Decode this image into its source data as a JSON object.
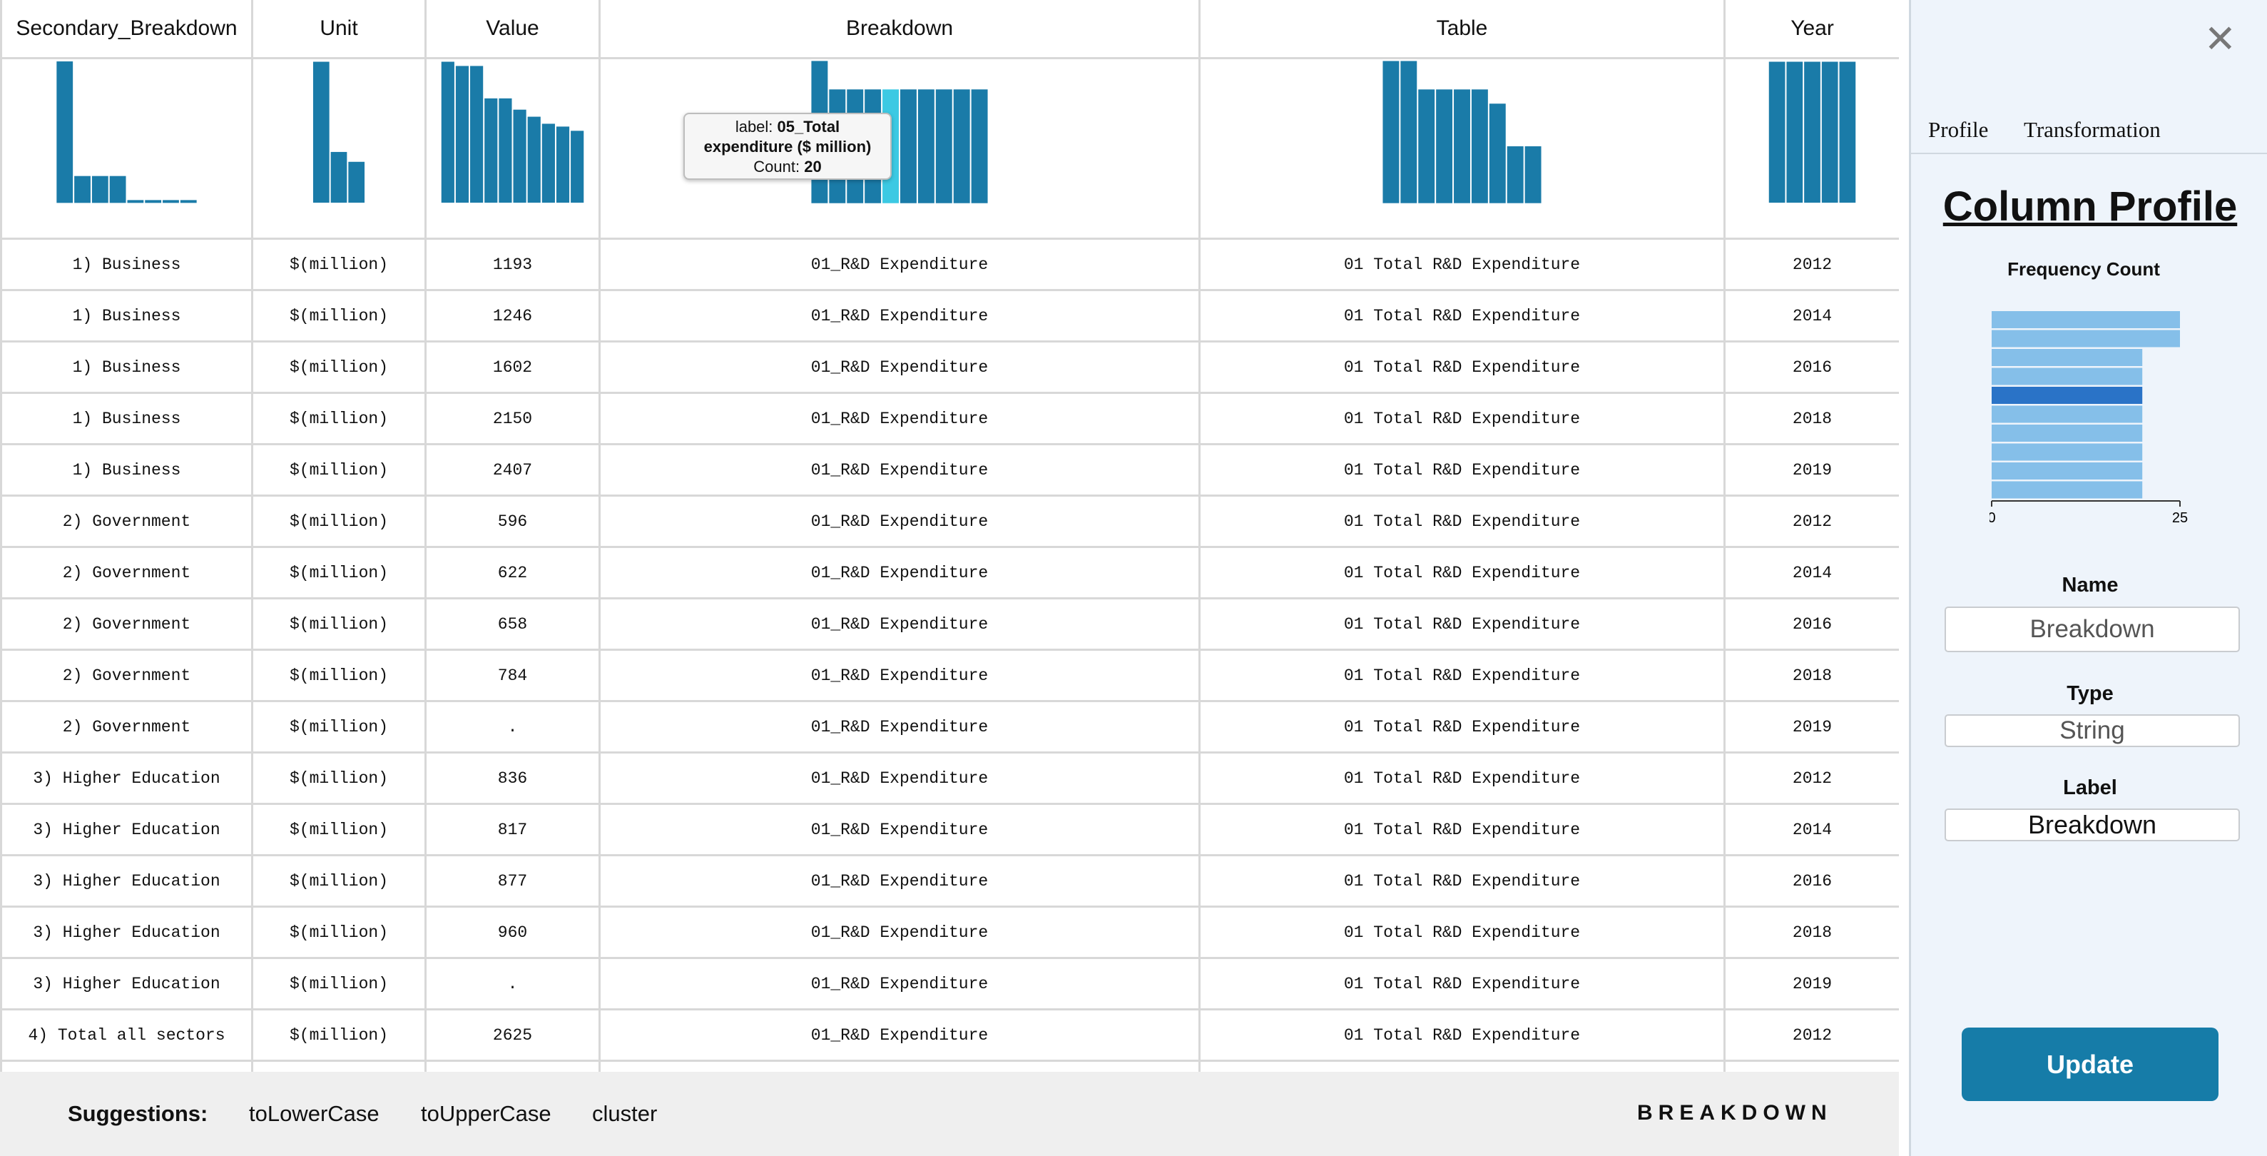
{
  "columns": [
    {
      "label": "Secondary_Breakdown",
      "hist": [
        1,
        0.19,
        0.19,
        0.19,
        0.02,
        0.02,
        0.02,
        0.02
      ]
    },
    {
      "label": "Unit",
      "hist": [
        1,
        0.36,
        0.29
      ]
    },
    {
      "label": "Value",
      "hist": [
        1,
        0.97,
        0.97,
        0.74,
        0.74,
        0.66,
        0.61,
        0.56,
        0.54,
        0.51
      ]
    },
    {
      "label": "Breakdown",
      "hist": [
        1,
        0.8,
        0.8,
        0.8,
        0.8,
        0.8,
        0.8,
        0.8,
        0.8,
        0.8
      ],
      "highlight": 4
    },
    {
      "label": "Table",
      "hist": [
        1,
        1,
        0.8,
        0.8,
        0.8,
        0.8,
        0.7,
        0.4,
        0.4
      ]
    },
    {
      "label": "Year",
      "hist": [
        1,
        1,
        1,
        1,
        1
      ]
    }
  ],
  "tooltip": {
    "label_prefix": "label: ",
    "label_value_a": "05_Total",
    "label_value_b": "expenditure ($ million)",
    "count_prefix": "Count: ",
    "count_value": "20"
  },
  "rows": [
    [
      "1) Business",
      "$(million)",
      "1193",
      "01_R&D Expenditure",
      "01 Total R&D Expenditure",
      "2012"
    ],
    [
      "1) Business",
      "$(million)",
      "1246",
      "01_R&D Expenditure",
      "01 Total R&D Expenditure",
      "2014"
    ],
    [
      "1) Business",
      "$(million)",
      "1602",
      "01_R&D Expenditure",
      "01 Total R&D Expenditure",
      "2016"
    ],
    [
      "1) Business",
      "$(million)",
      "2150",
      "01_R&D Expenditure",
      "01 Total R&D Expenditure",
      "2018"
    ],
    [
      "1) Business",
      "$(million)",
      "2407",
      "01_R&D Expenditure",
      "01 Total R&D Expenditure",
      "2019"
    ],
    [
      "2) Government",
      "$(million)",
      "596",
      "01_R&D Expenditure",
      "01 Total R&D Expenditure",
      "2012"
    ],
    [
      "2) Government",
      "$(million)",
      "622",
      "01_R&D Expenditure",
      "01 Total R&D Expenditure",
      "2014"
    ],
    [
      "2) Government",
      "$(million)",
      "658",
      "01_R&D Expenditure",
      "01 Total R&D Expenditure",
      "2016"
    ],
    [
      "2) Government",
      "$(million)",
      "784",
      "01_R&D Expenditure",
      "01 Total R&D Expenditure",
      "2018"
    ],
    [
      "2) Government",
      "$(million)",
      ".",
      "01_R&D Expenditure",
      "01 Total R&D Expenditure",
      "2019"
    ],
    [
      "3) Higher Education",
      "$(million)",
      "836",
      "01_R&D Expenditure",
      "01 Total R&D Expenditure",
      "2012"
    ],
    [
      "3) Higher Education",
      "$(million)",
      "817",
      "01_R&D Expenditure",
      "01 Total R&D Expenditure",
      "2014"
    ],
    [
      "3) Higher Education",
      "$(million)",
      "877",
      "01_R&D Expenditure",
      "01 Total R&D Expenditure",
      "2016"
    ],
    [
      "3) Higher Education",
      "$(million)",
      "960",
      "01_R&D Expenditure",
      "01 Total R&D Expenditure",
      "2018"
    ],
    [
      "3) Higher Education",
      "$(million)",
      ".",
      "01_R&D Expenditure",
      "01 Total R&D Expenditure",
      "2019"
    ],
    [
      "4) Total all sectors",
      "$(million)",
      "2625",
      "01_R&D Expenditure",
      "01 Total R&D Expenditure",
      "2012"
    ],
    [
      "",
      "",
      "",
      "",
      "",
      ""
    ]
  ],
  "suggestions": {
    "label": "Suggestions:",
    "items": [
      "toLowerCase",
      "toUpperCase",
      "cluster"
    ],
    "column": "BREAKDOWN"
  },
  "panel": {
    "close_icon": "close-icon",
    "tabs": [
      "Profile",
      "Transformation"
    ],
    "title": "Column Profile",
    "freq_title": "Frequency Count",
    "freq_counts": [
      25,
      25,
      20,
      20,
      20,
      20,
      20,
      20,
      20,
      20
    ],
    "freq_highlight": 4,
    "axis_min": "0",
    "axis_max": "25",
    "name_label": "Name",
    "name_value": "Breakdown",
    "type_label": "Type",
    "type_value": "String",
    "label_label": "Label",
    "label_value": "Breakdown",
    "update_label": "Update"
  },
  "colors": {
    "bar": "#1a7ba8",
    "bar_hl": "#3cc9e3",
    "freq_bar": "#85bfe9",
    "freq_hl": "#2a73c7"
  }
}
